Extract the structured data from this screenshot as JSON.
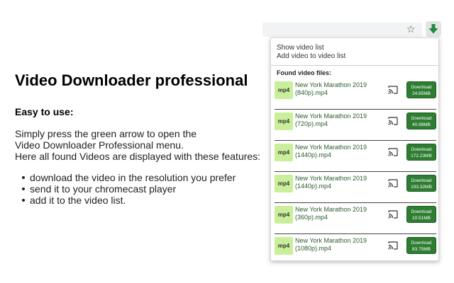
{
  "promo": {
    "title": "Video Downloader professional",
    "easy_heading": "Easy to use:",
    "description": [
      "Simply press the green arrow to open the",
      "Video Downloader Professional menu.",
      "Here all found Videos are displayed with these features:"
    ],
    "features": [
      "download the video in the resolution you prefer",
      "send it to your chromecast player",
      "add it to the video list."
    ]
  },
  "toolbar": {
    "bookmark_icon": "star-icon",
    "extension_icon": "download-arrow-icon",
    "extension_color": "#1e8e3e"
  },
  "popup": {
    "menu": {
      "show_list": "Show video list",
      "add_list": "Add video to video list"
    },
    "found_heading": "Found video files:",
    "items": [
      {
        "badge": "mp4",
        "line1": "New York Marathon 2019",
        "line2": "(840p).mp4",
        "dl_label": "Download",
        "size": "24.85MB"
      },
      {
        "badge": "mp4",
        "line1": "New York Marathon 2019",
        "line2": "(720p).mp4",
        "dl_label": "Download",
        "size": "40.98MB"
      },
      {
        "badge": "mp4",
        "line1": "New York Marathon 2019",
        "line2": "(1440p).mp4",
        "dl_label": "Download",
        "size": "172.23MB"
      },
      {
        "badge": "mp4",
        "line1": "New York Marathon 2019",
        "line2": "(1440p).mp4",
        "dl_label": "Download",
        "size": "193.32MB"
      },
      {
        "badge": "mp4",
        "line1": "New York Marathon 2019",
        "line2": "(360p).mp4",
        "dl_label": "Download",
        "size": "10.51MB"
      },
      {
        "badge": "mp4",
        "line1": "New York Marathon 2019",
        "line2": "(1080p).mp4",
        "dl_label": "Download",
        "size": "83.75MB"
      }
    ],
    "colors": {
      "thumb_bg": "#c9ef9a",
      "download_bg": "#2e7d32",
      "title_text": "#2b5b2b"
    }
  }
}
